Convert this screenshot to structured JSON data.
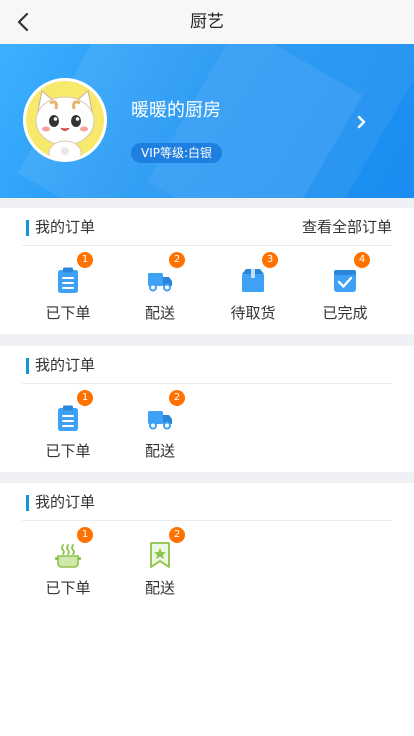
{
  "nav": {
    "title": "厨艺"
  },
  "profile": {
    "name": "暖暖的厨房",
    "vip": "VIP等级:白银"
  },
  "sections": [
    {
      "title": "我的订单",
      "more": "查看全部订单",
      "items": [
        {
          "label": "已下单",
          "badge": "1",
          "icon": "clipboard-icon"
        },
        {
          "label": "配送",
          "badge": "2",
          "icon": "truck-icon"
        },
        {
          "label": "待取货",
          "badge": "3",
          "icon": "box-icon"
        },
        {
          "label": "已完成",
          "badge": "4",
          "icon": "check-square-icon"
        }
      ]
    },
    {
      "title": "我的订单",
      "items": [
        {
          "label": "已下单",
          "badge": "1",
          "icon": "clipboard-icon"
        },
        {
          "label": "配送",
          "badge": "2",
          "icon": "truck-icon"
        }
      ]
    },
    {
      "title": "我的订单",
      "items": [
        {
          "label": "已下单",
          "badge": "1",
          "icon": "steaming-pot-icon"
        },
        {
          "label": "配送",
          "badge": "2",
          "icon": "star-bookmark-icon"
        }
      ]
    }
  ],
  "colors": {
    "accent": "#1296db",
    "badge": "#ff7200",
    "banner": "#2196f3",
    "green_icon": "#8bc34a"
  }
}
